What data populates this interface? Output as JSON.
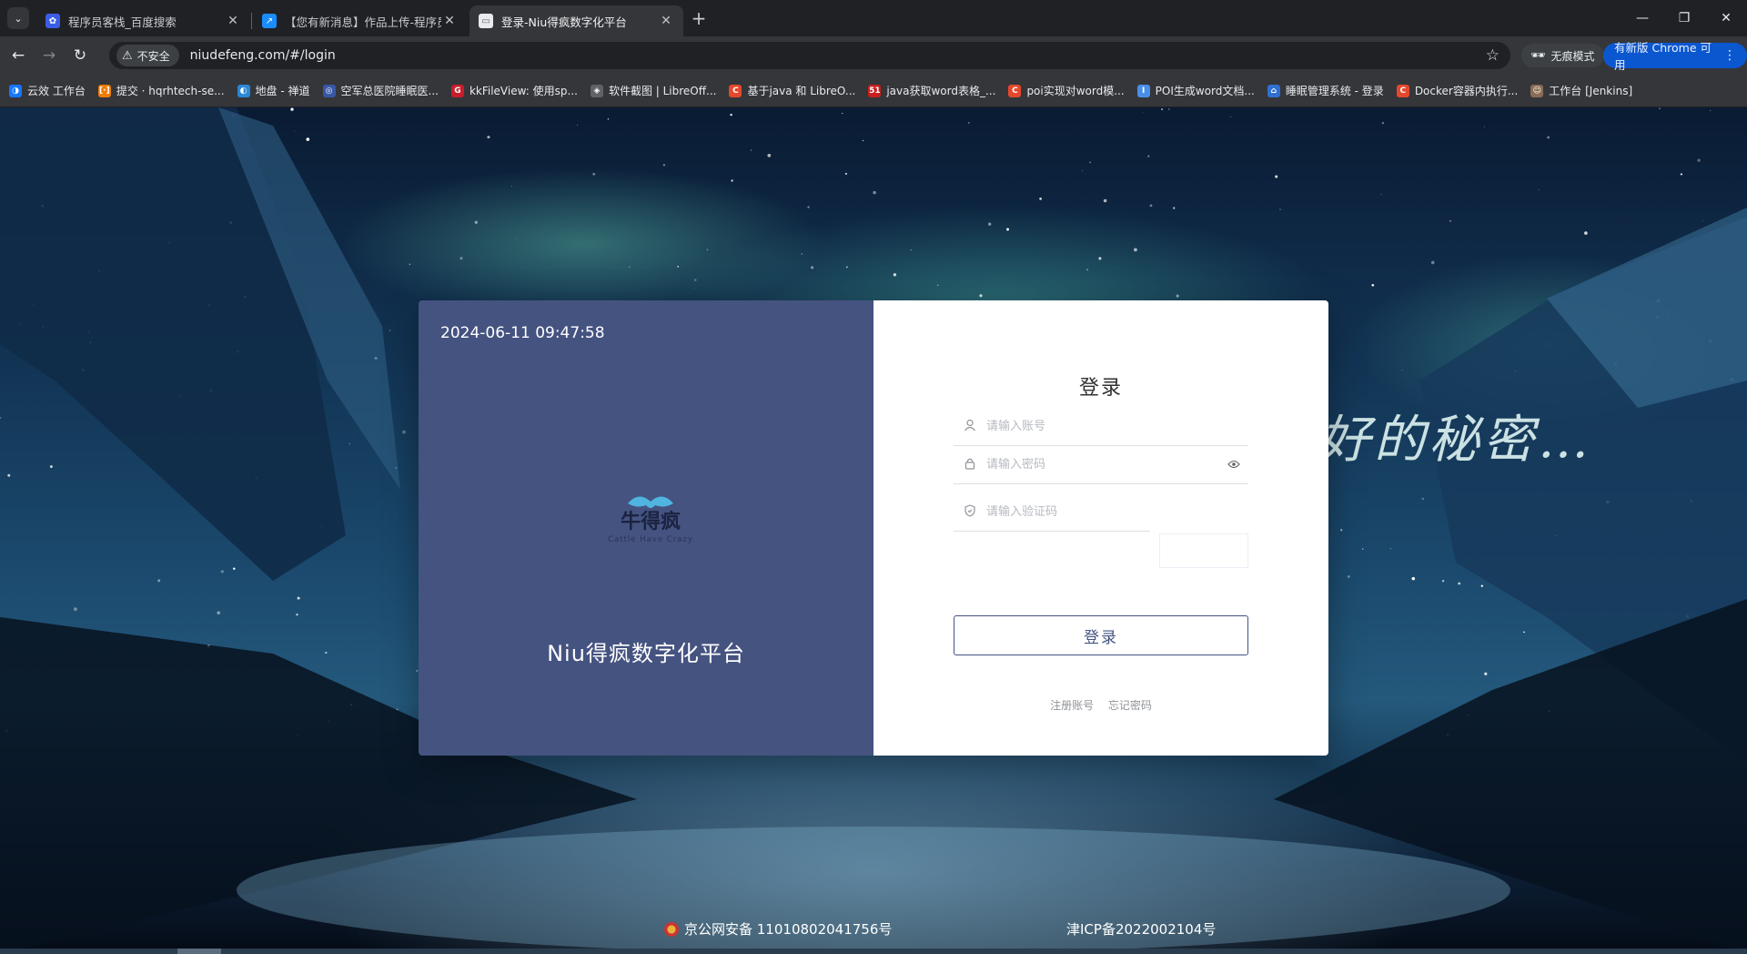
{
  "browser": {
    "tabs": [
      {
        "title": "程序员客栈_百度搜索",
        "favicon_color": "#3b5ee6",
        "active": false
      },
      {
        "title": "【您有新消息】作品上传-程序员",
        "favicon_color": "#1a8cff",
        "active": false
      },
      {
        "title": "登录-Niu得疯数字化平台",
        "favicon_color": "#e8eaed",
        "active": true
      }
    ],
    "security_label": "不安全",
    "url": "niudefeng.com/#/login",
    "incognito_label": "无痕模式",
    "update_label": "有新版 Chrome 可用",
    "bookmarks": [
      {
        "label": "云效 工作台",
        "color": "#1677ff",
        "glyph": "◑"
      },
      {
        "label": "提交 · hqrhtech-se...",
        "color": "#f07c00",
        "glyph": "[·]"
      },
      {
        "label": "地盘 - 禅道",
        "color": "#2b88d8",
        "glyph": "◐"
      },
      {
        "label": "空军总医院睡眠医...",
        "color": "#3857a6",
        "glyph": "◎"
      },
      {
        "label": "kkFileView: 使用sp...",
        "color": "#c81e2c",
        "glyph": "G"
      },
      {
        "label": "软件截图 | LibreOff...",
        "color": "#5f6368",
        "glyph": "◈"
      },
      {
        "label": "基于java 和 LibreO...",
        "color": "#e5482d",
        "glyph": "C"
      },
      {
        "label": "java获取word表格_...",
        "color": "#c71f1f",
        "glyph": "51"
      },
      {
        "label": "poi实现对word模...",
        "color": "#e5482d",
        "glyph": "C"
      },
      {
        "label": "POI生成word文档...",
        "color": "#4a8fe7",
        "glyph": "I"
      },
      {
        "label": "睡眠管理系统 - 登录",
        "color": "#2f6fd1",
        "glyph": "⌂"
      },
      {
        "label": "Docker容器内执行...",
        "color": "#e5482d",
        "glyph": "C"
      },
      {
        "label": "工作台 [Jenkins]",
        "color": "#8a6d54",
        "glyph": "☺"
      }
    ]
  },
  "page": {
    "background_slogan": "好的秘密…",
    "datetime": "2024-06-11 09:47:58",
    "logo": {
      "main": "牛得疯",
      "sub": "Cattle Have Crazy"
    },
    "platform_name": "Niu得疯数字化平台",
    "login": {
      "title": "登录",
      "account_placeholder": "请输入账号",
      "password_placeholder": "请输入密码",
      "captcha_placeholder": "请输入验证码",
      "submit_label": "登录",
      "register_link": "注册账号",
      "forgot_link": "忘记密码"
    },
    "footer": {
      "police_record": "京公网安备 11010802041756号",
      "icp_record": "津ICP备2022002104号"
    },
    "accent_color": "#455381"
  }
}
